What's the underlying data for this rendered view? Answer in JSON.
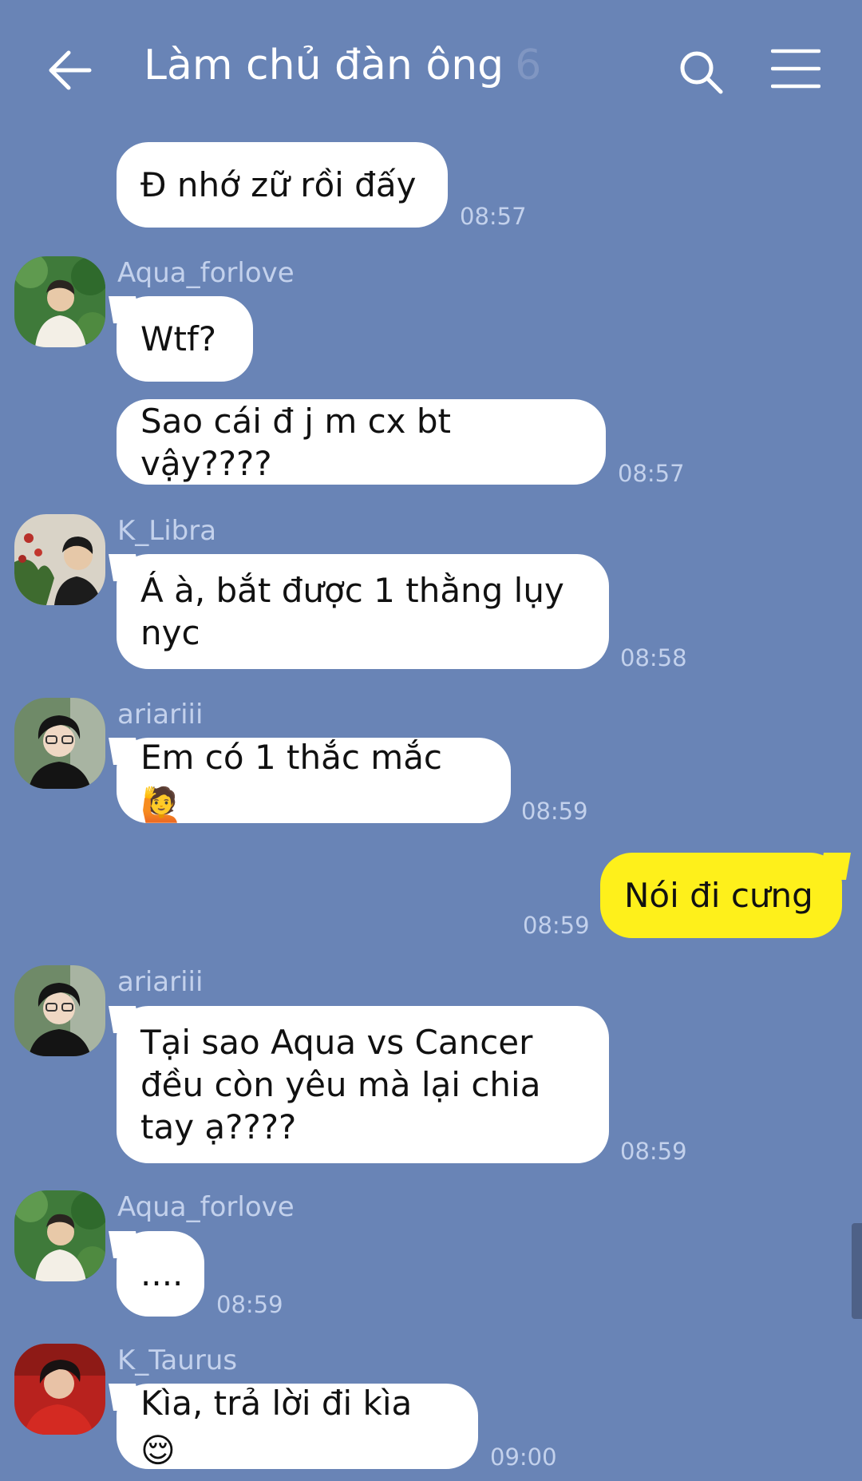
{
  "header": {
    "title": "Làm chủ đàn ông",
    "member_count": "6",
    "back_icon": "arrow-left-icon",
    "search_icon": "search-icon",
    "menu_icon": "hamburger-menu-icon"
  },
  "messages": [
    {
      "text": "Đ nhớ zữ rồi đấy",
      "time": "08:57"
    },
    {
      "sender": "Aqua_forlove",
      "text": "Wtf?"
    },
    {
      "text": "Sao cái đ j m cx bt vậy????",
      "time": "08:57"
    },
    {
      "sender": "K_Libra",
      "text": "Á à, bắt được 1 thằng lụy\nnyc",
      "time": "08:58"
    },
    {
      "sender": "ariariii",
      "text": "Em có 1 thắc mắc",
      "emoji": "🙋",
      "time": "08:59"
    },
    {
      "text": "Nói đi cưng",
      "time": "08:59",
      "mine": true
    },
    {
      "sender": "ariariii",
      "text": "Tại sao Aqua vs Cancer\nđều còn yêu mà lại chia\ntay ạ????",
      "time": "08:59"
    },
    {
      "sender": "Aqua_forlove",
      "text": "....",
      "time": "08:59"
    },
    {
      "sender": "K_Taurus",
      "text": "Kìa, trả lời đi kìa",
      "emoji": "😌",
      "time": "09:00"
    }
  ],
  "colors": {
    "background": "#6984b6",
    "my_bubble": "#fef01b",
    "other_bubble": "#ffffff",
    "meta_text": "#c3d1ec"
  }
}
